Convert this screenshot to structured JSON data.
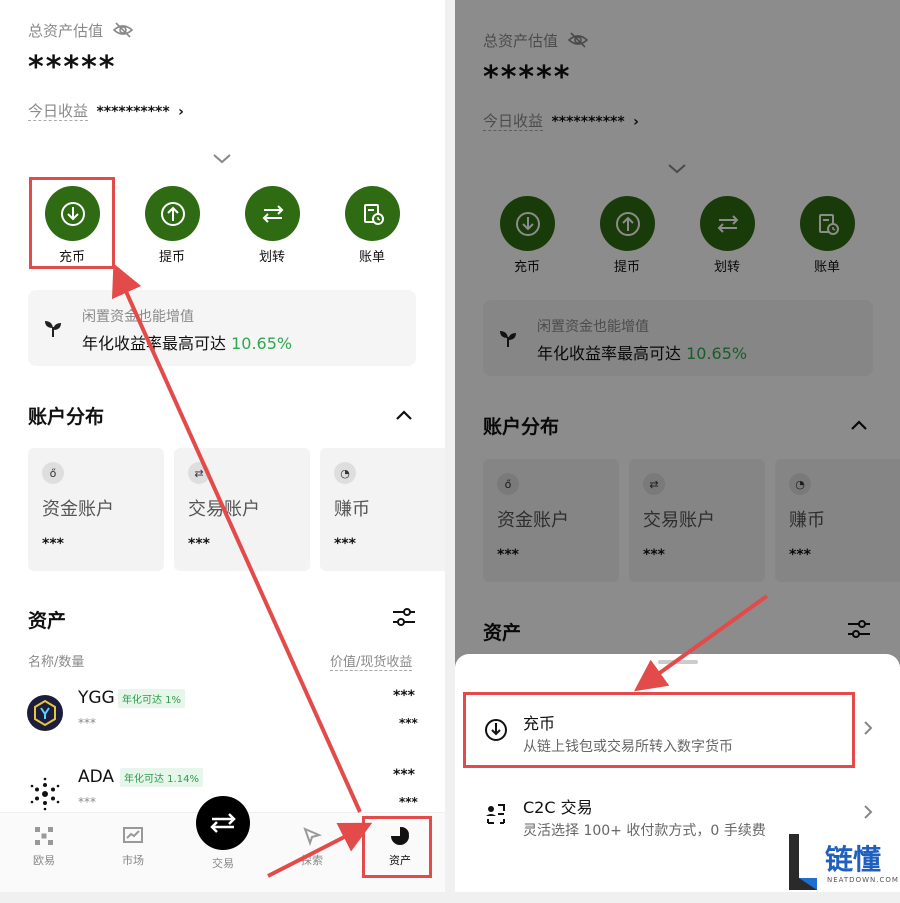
{
  "colors": {
    "accent_green": "#2e6b12",
    "yield_green": "#2fa84f",
    "annotation_red": "#e34a4a"
  },
  "left": {
    "total_label": "总资产估值",
    "total_value": "*****",
    "today_label": "今日收益",
    "today_value": "**********",
    "actions": [
      {
        "label": "充币",
        "icon": "deposit-icon"
      },
      {
        "label": "提币",
        "icon": "withdraw-icon"
      },
      {
        "label": "划转",
        "icon": "transfer-icon"
      },
      {
        "label": "账单",
        "icon": "bill-icon"
      }
    ],
    "promo": {
      "line1": "闲置资金也能增值",
      "line2": "年化收益率最高可达",
      "rate": "10.65%"
    },
    "dist_title": "账户分布",
    "accounts": [
      {
        "name": "资金账户",
        "value": "***"
      },
      {
        "name": "交易账户",
        "value": "***"
      },
      {
        "name": "赚币",
        "value": "***"
      }
    ],
    "assets_title": "资产",
    "col_left": "名称/数量",
    "col_right": "价值/现货收益",
    "coins": [
      {
        "symbol": "YGG",
        "badge": "年化可达 1%",
        "qty": "***",
        "value": "***",
        "sub": "***"
      },
      {
        "symbol": "ADA",
        "badge": "年化可达 1.14%",
        "qty": "***",
        "value": "***",
        "sub": "***"
      }
    ],
    "nav": [
      {
        "label": "欧易"
      },
      {
        "label": "市场"
      },
      {
        "label": "交易"
      },
      {
        "label": "探索"
      },
      {
        "label": "资产"
      }
    ]
  },
  "right": {
    "total_label": "总资产估值",
    "total_value": "*****",
    "today_label": "今日收益",
    "today_value": "**********",
    "actions": [
      {
        "label": "充币"
      },
      {
        "label": "提币"
      },
      {
        "label": "划转"
      },
      {
        "label": "账单"
      }
    ],
    "promo": {
      "line1": "闲置资金也能增值",
      "line2": "年化收益率最高可达",
      "rate": "10.65%"
    },
    "dist_title": "账户分布",
    "accounts": [
      {
        "name": "资金账户",
        "value": "***"
      },
      {
        "name": "交易账户",
        "value": "***"
      },
      {
        "name": "赚币",
        "value": "***"
      }
    ],
    "assets_title": "资产",
    "sheet": [
      {
        "title": "充币",
        "subtitle": "从链上钱包或交易所转入数字货币"
      },
      {
        "title": "C2C 交易",
        "subtitle": "灵活选择 100+ 收付款方式，0 手续费"
      }
    ]
  },
  "watermark": {
    "brand": "链懂",
    "domain": "NEATDOWN.COM"
  }
}
